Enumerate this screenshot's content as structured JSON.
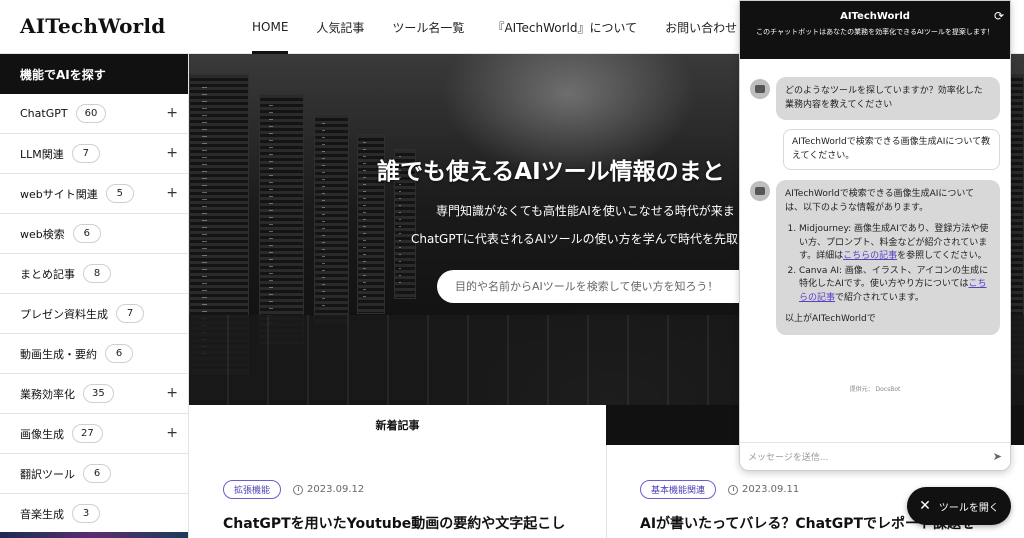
{
  "header": {
    "logo": "AITechWorld",
    "nav": [
      "HOME",
      "人気記事",
      "ツール名一覧",
      "『AITechWorld』について",
      "お問い合わせとリク"
    ]
  },
  "sidebar": {
    "title": "機能でAIを探す",
    "items": [
      {
        "label": "ChatGPT",
        "count": "60",
        "expand": "+"
      },
      {
        "label": "LLM関連",
        "count": "7",
        "expand": "+"
      },
      {
        "label": "webサイト関連",
        "count": "5",
        "expand": "+"
      },
      {
        "label": "web検索",
        "count": "6",
        "expand": ""
      },
      {
        "label": "まとめ記事",
        "count": "8",
        "expand": ""
      },
      {
        "label": "プレゼン資料生成",
        "count": "7",
        "expand": ""
      },
      {
        "label": "動画生成・要約",
        "count": "6",
        "expand": ""
      },
      {
        "label": "業務効率化",
        "count": "35",
        "expand": "+"
      },
      {
        "label": "画像生成",
        "count": "27",
        "expand": "+"
      },
      {
        "label": "翻訳ツール",
        "count": "6",
        "expand": ""
      },
      {
        "label": "音楽生成",
        "count": "3",
        "expand": ""
      }
    ]
  },
  "hero": {
    "title": "誰でも使えるAIツール情報のまと",
    "subtitle1": "専門知識がなくても高性能AIを使いこなせる時代が来ま",
    "subtitle2": "ChatGPTに代表されるAIツールの使い方を学んで時代を先取",
    "search_placeholder": "目的や名前からAIツールを検索して使い方を知ろう！"
  },
  "articles": {
    "tab_new": "新着記事",
    "items": [
      {
        "tag": "拡張機能",
        "date": "2023.09.12",
        "title": "ChatGPTを用いたYoutube動画の要約や文字起こし"
      },
      {
        "tag": "基本機能関連",
        "date": "2023.09.11",
        "title": "AIが書いたってバレる？ChatGPTでレポート課題を"
      }
    ]
  },
  "chat": {
    "title": "AITechWorld",
    "subtitle": "このチャットボットはあなたの業務を効率化できるAIツールを提案します！",
    "msg1": "どのようなツールを探していますか？効率化した業務内容を教えてください",
    "user_msg": "AITechWorldで検索できる画像生成AIについて教えてください。",
    "answer_intro": "AITechWorldで検索できる画像生成AIについては、以下のような情報があります。",
    "answer_items": [
      {
        "pre": "Midjourney: 画像生成AIであり、登録方法や使い方、プロンプト、料金などが紹介されています。詳細は",
        "link": "こちらの記事",
        "post": "を参照してください。"
      },
      {
        "pre": "Canva AI: 画像、イラスト、アイコンの生成に特化したAIです。使い方やり方については",
        "link": "こちらの記事",
        "post": "で紹介されています。"
      }
    ],
    "answer_outro": "以上がAITechWorldで",
    "powered": "提供元： DocsBot",
    "input_placeholder": "メッセージを送信...",
    "open_button": "ツールを開く"
  }
}
